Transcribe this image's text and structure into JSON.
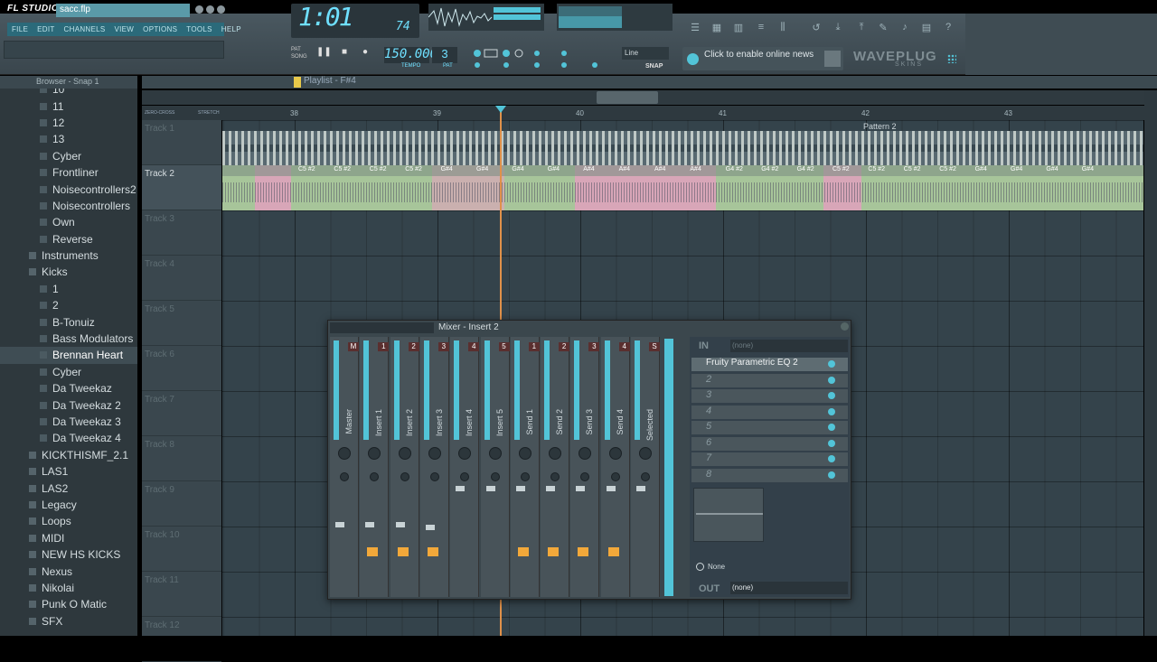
{
  "app": {
    "logo": "FL STUDIO",
    "filename": "sacc.flp"
  },
  "menu": [
    "FILE",
    "EDIT",
    "CHANNELS",
    "VIEW",
    "OPTIONS",
    "TOOLS",
    "HELP"
  ],
  "lcd": {
    "time": "1:01",
    "ms": "74"
  },
  "transport": {
    "pat_label": "PAT",
    "song_label": "SONG",
    "tempo": "150.000",
    "tempo_label": "TEMPO",
    "pattern": "3",
    "pattern_label": "PAT"
  },
  "snap": {
    "value": "Line",
    "label": "SNAP"
  },
  "news": "Click to enable online news",
  "brand": {
    "name": "WAVEPLUG",
    "sub": "SKINS"
  },
  "browser": {
    "title": "Browser - Snap 1",
    "items": [
      {
        "label": "10",
        "indent": 3
      },
      {
        "label": "11",
        "indent": 3
      },
      {
        "label": "12",
        "indent": 3
      },
      {
        "label": "13",
        "indent": 3
      },
      {
        "label": "Cyber",
        "indent": 3
      },
      {
        "label": "Frontliner",
        "indent": 3
      },
      {
        "label": "Noisecontrollers2",
        "indent": 3
      },
      {
        "label": "Noisecontrollers",
        "indent": 3
      },
      {
        "label": "Own",
        "indent": 3
      },
      {
        "label": "Reverse",
        "indent": 3
      },
      {
        "label": "Instruments",
        "indent": 2
      },
      {
        "label": "Kicks",
        "indent": 2
      },
      {
        "label": "1",
        "indent": 3
      },
      {
        "label": "2",
        "indent": 3
      },
      {
        "label": "B-Tonuiz",
        "indent": 3
      },
      {
        "label": "Bass Modulators",
        "indent": 3
      },
      {
        "label": "Brennan Heart",
        "indent": 3,
        "selected": true
      },
      {
        "label": "Cyber",
        "indent": 3
      },
      {
        "label": "Da Tweekaz",
        "indent": 3
      },
      {
        "label": "Da Tweekaz 2",
        "indent": 3
      },
      {
        "label": "Da Tweekaz 3",
        "indent": 3
      },
      {
        "label": "Da Tweekaz 4",
        "indent": 3
      },
      {
        "label": "KICKTHISMF_2.1",
        "indent": 2
      },
      {
        "label": "LAS1",
        "indent": 2
      },
      {
        "label": "LAS2",
        "indent": 2
      },
      {
        "label": "Legacy",
        "indent": 2
      },
      {
        "label": "Loops",
        "indent": 2
      },
      {
        "label": "MIDI",
        "indent": 2
      },
      {
        "label": "NEW HS KICKS",
        "indent": 2
      },
      {
        "label": "Nexus",
        "indent": 2
      },
      {
        "label": "Nikolai",
        "indent": 2
      },
      {
        "label": "Punk O Matic",
        "indent": 2
      },
      {
        "label": "SFX",
        "indent": 2
      }
    ]
  },
  "playlist": {
    "title": "Playlist - F#4",
    "ruler": [
      "38",
      "39",
      "40",
      "41",
      "42",
      "43"
    ],
    "tracks": [
      "Track 1",
      "Track 2",
      "Track 3",
      "Track 4",
      "Track 5",
      "Track 6",
      "Track 7",
      "Track 8",
      "Track 9",
      "Track 10",
      "Track 11",
      "Track 12"
    ],
    "pattern_label": "Pattern 2",
    "zero_cross": "ZERO-CROSS",
    "stretch": "STRETCH",
    "clip_notes": [
      "C5 #2",
      "C5 #2",
      "C5 #2",
      "C5 #2",
      "G#4",
      "G#4",
      "G#4",
      "G#4",
      "A#4",
      "A#4",
      "A#4",
      "A#4",
      "G4 #2",
      "G4 #2",
      "G4 #2",
      "C5 #2",
      "C5 #2",
      "C5 #2",
      "C5 #2",
      "G#4",
      "G#4",
      "G#4",
      "G#4"
    ]
  },
  "mixer": {
    "title": "Mixer - Insert 2",
    "strips": [
      {
        "label": "Master",
        "num": "M"
      },
      {
        "label": "Insert 1",
        "num": "1"
      },
      {
        "label": "Insert 2",
        "num": "2"
      },
      {
        "label": "Insert 3",
        "num": "3"
      },
      {
        "label": "Insert 4",
        "num": "4"
      },
      {
        "label": "Insert 5",
        "num": "5"
      },
      {
        "label": "Send 1",
        "num": "1"
      },
      {
        "label": "Send 2",
        "num": "2"
      },
      {
        "label": "Send 3",
        "num": "3"
      },
      {
        "label": "Send 4",
        "num": "4"
      },
      {
        "label": "Selected",
        "num": "S"
      }
    ],
    "in_label": "IN",
    "in_value": "(none)",
    "slots": [
      "Fruity Parametric EQ 2",
      "2",
      "3",
      "4",
      "5",
      "6",
      "7",
      "8"
    ],
    "none_label": "None",
    "out_label": "OUT",
    "out_value": "(none)"
  },
  "colors": {
    "accent": "#52c4d8",
    "lcd": "#6fe0ff",
    "playhead": "#e0914a",
    "clip_green": "#a7c59a",
    "clip_pink": "#d8a6b8"
  }
}
